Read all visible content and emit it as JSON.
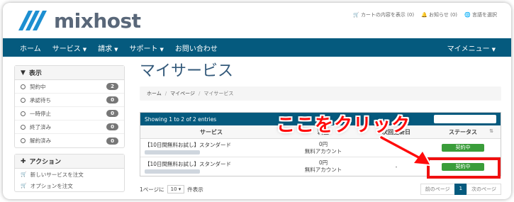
{
  "brand": {
    "name": "mixhost"
  },
  "toplinks": [
    {
      "icon": "cart-icon",
      "label": "カートの内容を表示 (0)"
    },
    {
      "icon": "bell-icon",
      "label": "お知らせ (0)"
    },
    {
      "icon": "language-icon",
      "label": "言語を選択"
    }
  ],
  "nav": {
    "items": [
      {
        "label": "ホーム",
        "dropdown": false
      },
      {
        "label": "サービス",
        "dropdown": true
      },
      {
        "label": "請求",
        "dropdown": true
      },
      {
        "label": "サポート",
        "dropdown": true
      },
      {
        "label": "お問い合わせ",
        "dropdown": false
      }
    ],
    "my_menu": "マイメニュー"
  },
  "sidebar": {
    "filter_title": "表示",
    "filters": [
      {
        "label": "契約中",
        "count": "2"
      },
      {
        "label": "承認待ち",
        "count": "0"
      },
      {
        "label": "一時停止",
        "count": "0"
      },
      {
        "label": "終了済み",
        "count": "0"
      },
      {
        "label": "解約済み",
        "count": "0"
      }
    ],
    "actions_title": "アクション",
    "actions": [
      {
        "label": "新しいサービスを注文"
      },
      {
        "label": "オプションを注文"
      }
    ]
  },
  "main": {
    "title": "マイサービス",
    "breadcrumb": [
      "ホーム",
      "マイページ",
      "マイサービス"
    ],
    "entries_info": "Showing 1 to 2 of 2 entries",
    "columns": {
      "service": "サービス",
      "price": "料金",
      "next_due": "次回更新日",
      "status": "ステータス"
    },
    "rows": [
      {
        "service": "【10日間無料お試し】スタンダード",
        "price": "0円",
        "cycle": "無料アカウント",
        "due": "-",
        "status": "契約中"
      },
      {
        "service": "【10日間無料お試し】スタンダード",
        "price": "0円",
        "cycle": "無料アカウント",
        "due": "-",
        "status": "契約中"
      }
    ],
    "per_page_prefix": "1ページに",
    "per_page_value": "10",
    "per_page_suffix": "件表示",
    "pager": {
      "prev": "前のページ",
      "current": "1",
      "next": "次のページ"
    }
  },
  "annotation": {
    "text": "ここをクリック",
    "color": "#ff0b0b"
  },
  "colors": {
    "brand_blue": "#055a7e",
    "status_green": "#3a9d3a",
    "title_blue": "#33597a"
  }
}
